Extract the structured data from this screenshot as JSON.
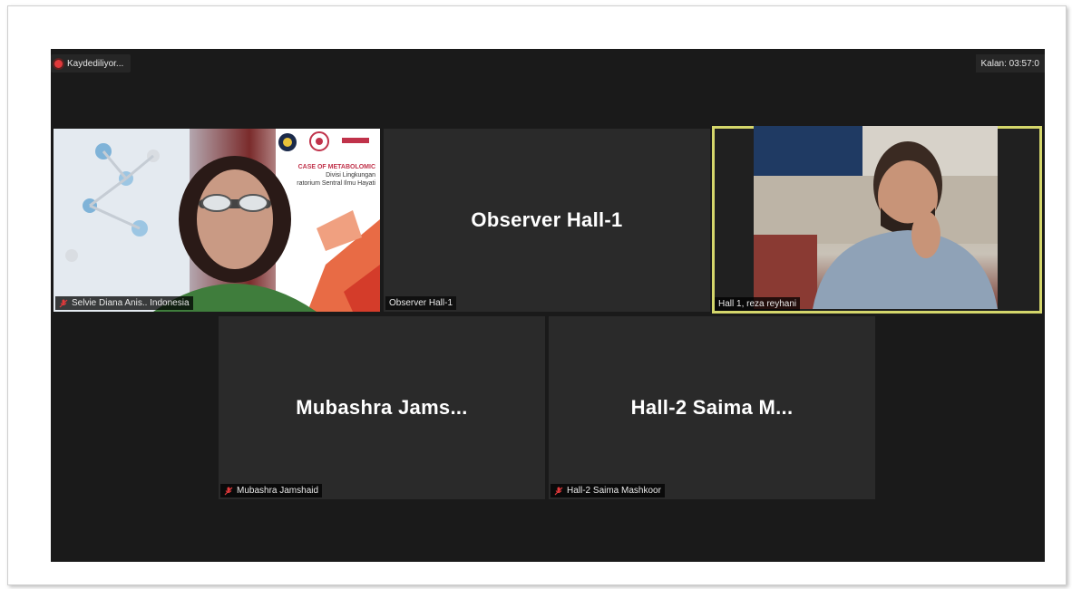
{
  "recording": {
    "label": "Kaydediliyor..."
  },
  "timer": {
    "label": "Kalan: 03:57:0"
  },
  "tiles": [
    {
      "title": "",
      "name": "Selvie Diana Anis.. Indonesia",
      "slide_text": [
        "CASE OF METABOLOMIC",
        "Divisi Lingkungan",
        "ratorium Sentral Ilmu Hayati"
      ]
    },
    {
      "title": "Observer Hall-1",
      "name": "Observer Hall-1"
    },
    {
      "title": "",
      "name": "Hall 1, reza reyhani"
    },
    {
      "title": "Mubashra  Jams...",
      "name": "Mubashra Jamshaid"
    },
    {
      "title": "Hall-2 Saima M...",
      "name": "Hall-2 Saima Mashkoor"
    }
  ],
  "colors": {
    "active_border": "#d4d66b",
    "background": "#1a1a1a",
    "tile": "#2a2a2a",
    "record": "#e0393b"
  }
}
